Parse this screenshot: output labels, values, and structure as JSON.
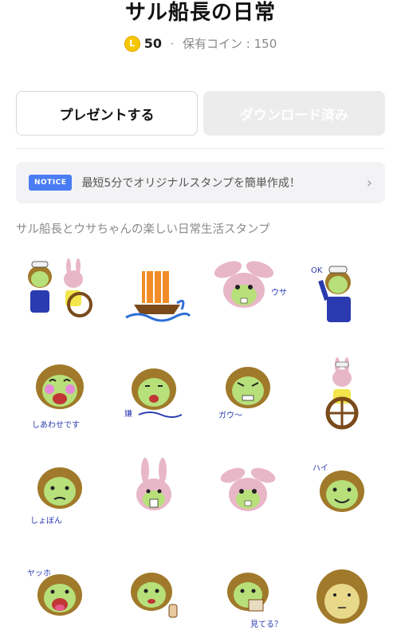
{
  "header": {
    "title": "サル船長の日常"
  },
  "price": {
    "coin_letter": "L",
    "amount": "50",
    "separator": "・",
    "owned_coins": "保有コイン : 150"
  },
  "buttons": {
    "present": "プレゼントする",
    "download": "ダウンロード済み"
  },
  "notice": {
    "badge": "NOTICE",
    "text": "最短5分でオリジナルスタンプを簡単作成！",
    "chevron": "›"
  },
  "description": "サル船長とウサちゃんの楽しい日常生活スタンプ",
  "colors": {
    "coin": "#f6c600",
    "notice_badge": "#4a7cf3",
    "monkey_fur": "#a07a2a",
    "monkey_face": "#b7e07a",
    "rabbit_fur": "#e8b7c7"
  },
  "stickers": [
    {
      "id": 1,
      "icon": "monkey-captain-and-rabbit-icon",
      "caption": ""
    },
    {
      "id": 2,
      "icon": "sailing-ship-icon",
      "caption": ""
    },
    {
      "id": 3,
      "icon": "rabbit-face-icon",
      "caption": "ウサ"
    },
    {
      "id": 4,
      "icon": "monkey-captain-salute-icon",
      "caption": "OK"
    },
    {
      "id": 5,
      "icon": "monkey-happy-icon",
      "caption": "しあわせです"
    },
    {
      "id": 6,
      "icon": "monkey-tongue-icon",
      "caption": "嫌"
    },
    {
      "id": 7,
      "icon": "monkey-angry-icon",
      "caption": "ガウ〜"
    },
    {
      "id": 8,
      "icon": "rabbit-steering-wheel-icon",
      "caption": ""
    },
    {
      "id": 9,
      "icon": "monkey-sad-icon",
      "caption": "しょぼん"
    },
    {
      "id": 10,
      "icon": "rabbit-shocked-icon",
      "caption": ""
    },
    {
      "id": 11,
      "icon": "rabbit-smile-icon",
      "caption": ""
    },
    {
      "id": 12,
      "icon": "monkey-smile-icon",
      "caption": "ハイ"
    },
    {
      "id": 13,
      "icon": "monkey-laugh-icon",
      "caption": "ヤッホ"
    },
    {
      "id": 14,
      "icon": "monkey-thumbsup-icon",
      "caption": ""
    },
    {
      "id": 15,
      "icon": "monkey-money-icon",
      "caption": "見てる？"
    },
    {
      "id": 16,
      "icon": "monkey-plain-face-icon",
      "caption": ""
    }
  ]
}
